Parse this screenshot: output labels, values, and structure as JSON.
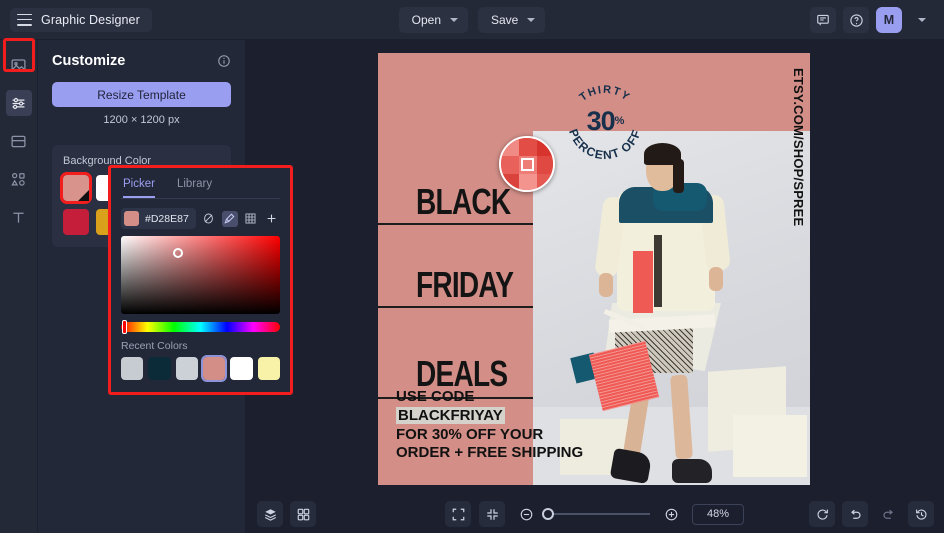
{
  "topbar": {
    "menu_icon": "hamburger-icon",
    "title": "Graphic Designer",
    "open_label": "Open",
    "save_label": "Save",
    "comment_icon": "comment-icon",
    "help_icon": "help-icon",
    "avatar_initial": "M"
  },
  "rail": {
    "items": [
      {
        "icon": "image-icon",
        "name": "images"
      },
      {
        "icon": "sliders-icon",
        "name": "customize"
      },
      {
        "icon": "layout-icon",
        "name": "layouts"
      },
      {
        "icon": "shapes-icon",
        "name": "elements"
      },
      {
        "icon": "text-icon",
        "name": "text"
      }
    ],
    "active_index": 1
  },
  "panel": {
    "title": "Customize",
    "info_icon": "info-icon",
    "resize_label": "Resize Template",
    "dimensions": "1200 × 1200 px",
    "background_color_label": "Background Color",
    "swatches_row1": [
      "#d8938c",
      "#ffffff",
      "#0f2a38"
    ],
    "swatches_row2": [
      "#c41e3a",
      "#d9a01c",
      "#1b4f66"
    ]
  },
  "picker": {
    "tabs": [
      "Picker",
      "Library"
    ],
    "active_tab": "Picker",
    "hex": "#D28E87",
    "chip_color": "#d28e87",
    "tools": [
      "no-color-icon",
      "eyedropper-icon",
      "palette-grid-icon",
      "add-icon"
    ],
    "active_tool": "eyedropper-icon",
    "recent_label": "Recent Colors",
    "recent_colors": [
      "#c7ccd3",
      "#0b2b38",
      "#ccd1d8",
      "#d28e87",
      "#ffffff",
      "#f7f2a8"
    ],
    "selected_recent_index": 3
  },
  "canvas": {
    "background": "#d28e87",
    "headlines": [
      "BLACK",
      "FRIDAY",
      "DEALS"
    ],
    "badge": {
      "top_text": "THIRTY",
      "center": "30",
      "center_sup": "%",
      "bottom_text": "PERCENT OFF"
    },
    "vertical_url": "ETSY.COM/SHOP/SPREE",
    "promo_lines": [
      "USE CODE",
      "BLACKFRIYAY",
      "FOR 30% OFF YOUR",
      "ORDER + FREE SHIPPING"
    ],
    "highlighted_line": "BLACKFRIYAY",
    "eyedropper_preview": "eyedropper-magnifier"
  },
  "bottombar": {
    "layers_icon": "layers-icon",
    "grid_icon": "grid-icon",
    "fit_icon": "fit-screen-icon",
    "collapse_icon": "collapse-icon",
    "zoom_out_icon": "zoom-out-icon",
    "zoom_in_icon": "zoom-in-icon",
    "zoom_value": "48%",
    "reset_icon": "reset-icon",
    "undo_icon": "undo-icon",
    "redo_icon": "redo-icon",
    "history_icon": "history-icon"
  }
}
